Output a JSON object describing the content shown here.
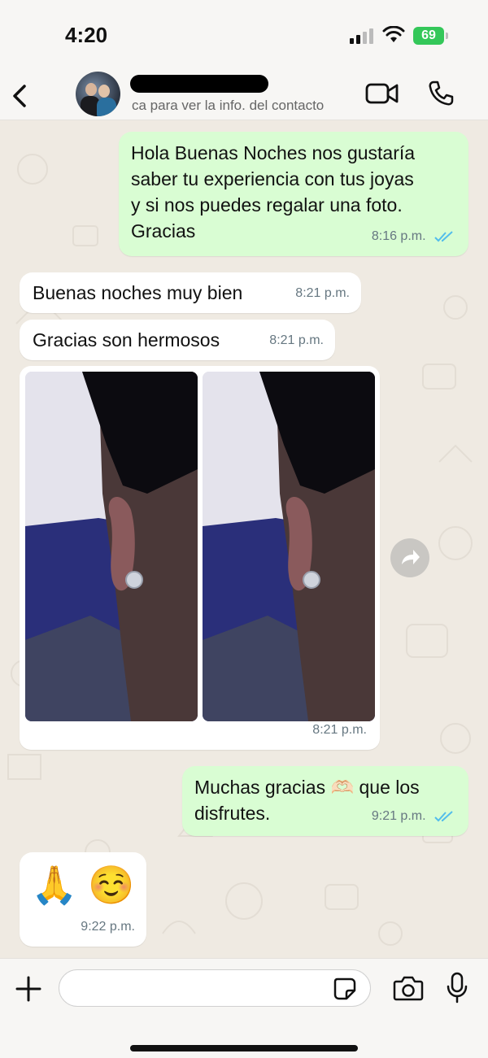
{
  "status_bar": {
    "time": "4:20",
    "battery": "69"
  },
  "header": {
    "subtitle": "ca para ver la info. del contacto"
  },
  "messages": [
    {
      "direction": "out",
      "text_lines": [
        "Hola Buenas Noches nos gustaría",
        "saber tu experiencia con tus joyas",
        "y si nos puedes regalar una foto.",
        "Gracias"
      ],
      "time": "8:16 p.m.",
      "read": true
    },
    {
      "direction": "in",
      "text": "Buenas noches muy bien",
      "time": "8:21 p.m."
    },
    {
      "direction": "in",
      "text": "Gracias son hermosos",
      "time": "8:21 p.m."
    },
    {
      "direction": "in",
      "type": "photos",
      "count": 2,
      "time": "8:21 p.m."
    },
    {
      "direction": "out",
      "text_lines": [
        "Muchas gracias 🫶🏻 que los",
        "disfrutes."
      ],
      "time": "9:21 p.m.",
      "read": true
    },
    {
      "direction": "in",
      "text": "🙏 ☺️",
      "time": "9:22 p.m."
    }
  ],
  "composer": {
    "placeholder": ""
  },
  "colors": {
    "outgoing": "#d9fdd3",
    "incoming": "#ffffff",
    "read_ticks": "#53bdeb",
    "background": "#efeae2"
  }
}
